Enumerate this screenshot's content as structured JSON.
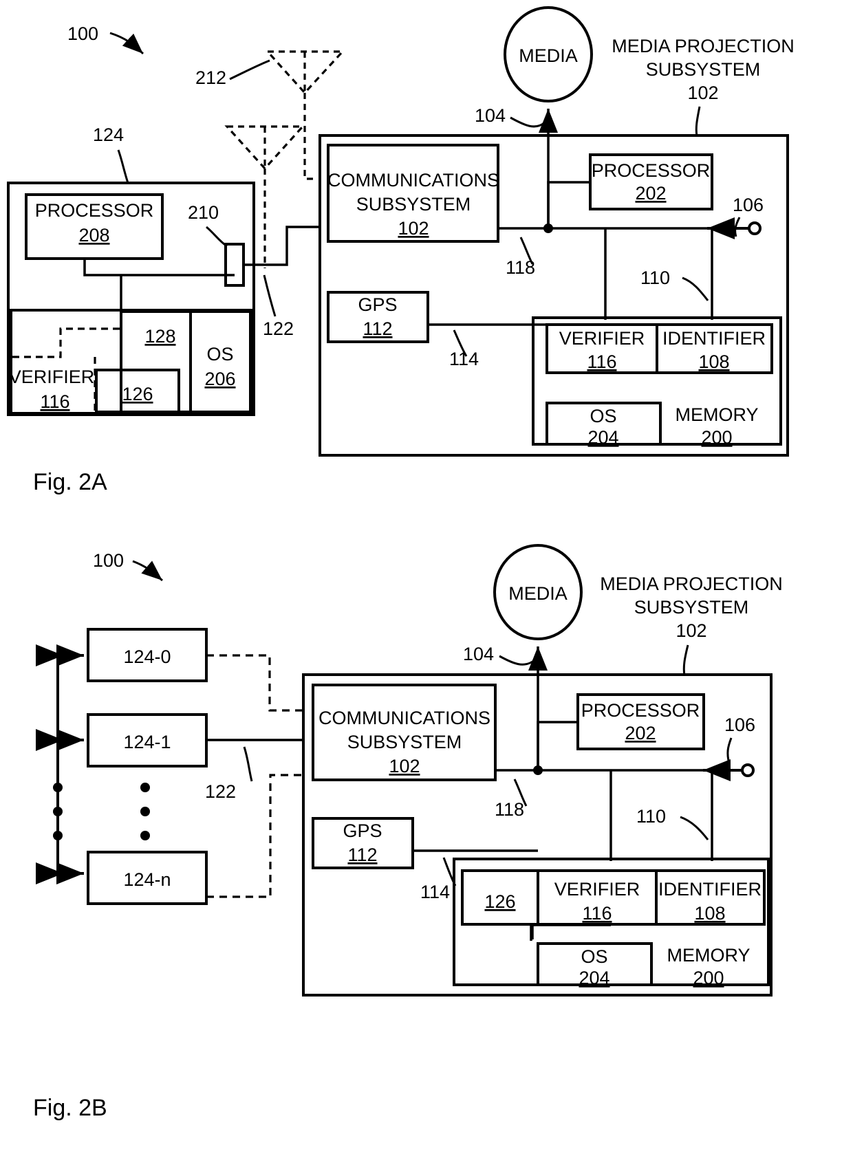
{
  "page": {
    "figures": [
      {
        "caption": "Fig. 2A",
        "system_ref": "100",
        "antenna_ref": "212",
        "device": {
          "ref": "124",
          "processor": {
            "title": "PROCESSOR",
            "ref": "208"
          },
          "transceiver_ref": "210",
          "memory_items": [
            {
              "title": "VERIFIER",
              "ref": "116"
            },
            {
              "title": "",
              "ref": "126"
            },
            {
              "title": "",
              "ref": "128"
            },
            {
              "title": "OS",
              "ref": "206"
            }
          ]
        },
        "link_ref": "122",
        "media": {
          "label": "MEDIA",
          "arrow_ref": "104"
        },
        "subsystem": {
          "title_line1": "MEDIA PROJECTION",
          "title_line2": "SUBSYSTEM",
          "ref": "102",
          "comms": {
            "title_line1": "COMMUNICATIONS",
            "title_line2": "SUBSYSTEM",
            "ref": "102"
          },
          "gps": {
            "title": "GPS",
            "ref": "112"
          },
          "processor": {
            "title": "PROCESSOR",
            "ref": "202"
          },
          "bus_ref": "118",
          "gps_bus_ref": "114",
          "memory_bus_ref": "110",
          "input_ref": "106",
          "memory": {
            "title": "MEMORY",
            "ref": "200",
            "items": [
              {
                "title": "VERIFIER",
                "ref": "116"
              },
              {
                "title": "IDENTIFIER",
                "ref": "108"
              },
              {
                "title": "OS",
                "ref": "204"
              }
            ]
          }
        }
      },
      {
        "caption": "Fig. 2B",
        "system_ref": "100",
        "devices": [
          "124-0",
          "124-1",
          "124-n"
        ],
        "link_ref": "122",
        "media": {
          "label": "MEDIA",
          "arrow_ref": "104"
        },
        "subsystem": {
          "title_line1": "MEDIA PROJECTION",
          "title_line2": "SUBSYSTEM",
          "ref": "102",
          "comms": {
            "title_line1": "COMMUNICATIONS",
            "title_line2": "SUBSYSTEM",
            "ref": "102"
          },
          "gps": {
            "title": "GPS",
            "ref": "112"
          },
          "processor": {
            "title": "PROCESSOR",
            "ref": "202"
          },
          "bus_ref": "118",
          "gps_bus_ref": "114",
          "memory_bus_ref": "110",
          "input_ref": "106",
          "memory": {
            "title": "MEMORY",
            "ref": "200",
            "items": [
              {
                "title": "",
                "ref": "126"
              },
              {
                "title": "VERIFIER",
                "ref": "116"
              },
              {
                "title": "IDENTIFIER",
                "ref": "108"
              },
              {
                "title": "OS",
                "ref": "204"
              }
            ]
          }
        }
      }
    ]
  }
}
